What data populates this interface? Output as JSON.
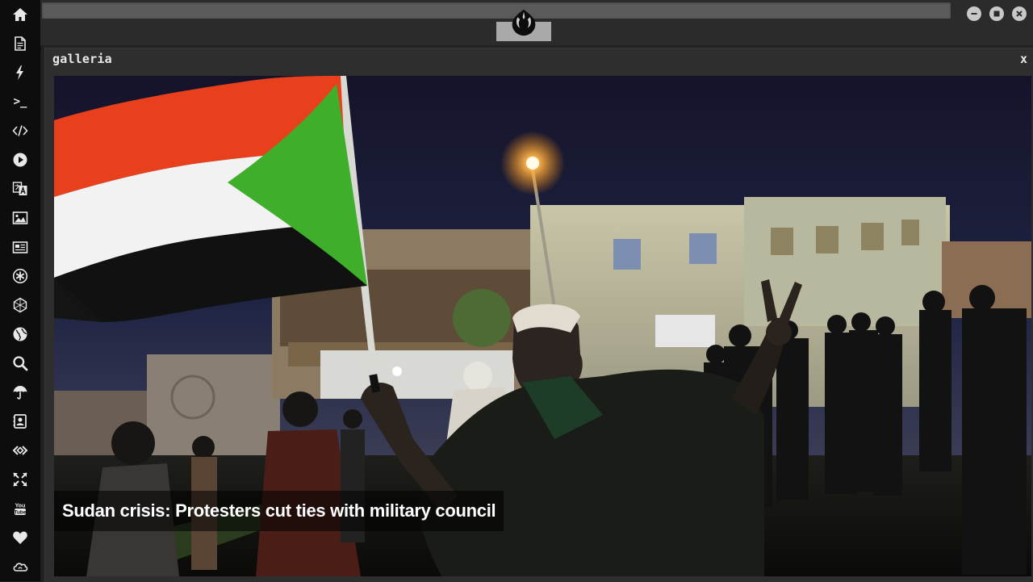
{
  "sidebar": {
    "items": [
      {
        "name": "home-icon"
      },
      {
        "name": "document-icon"
      },
      {
        "name": "lightning-icon"
      },
      {
        "name": "terminal-icon",
        "label": ">_"
      },
      {
        "name": "code-icon",
        "label": "</>"
      },
      {
        "name": "play-icon"
      },
      {
        "name": "translate-icon"
      },
      {
        "name": "image-icon"
      },
      {
        "name": "news-icon"
      },
      {
        "name": "asterisk-icon"
      },
      {
        "name": "hexagon-icon"
      },
      {
        "name": "globe-icon"
      },
      {
        "name": "search-icon"
      },
      {
        "name": "umbrella-icon"
      },
      {
        "name": "contact-card-icon"
      },
      {
        "name": "diamond-code-icon"
      },
      {
        "name": "expand-icon"
      },
      {
        "name": "youtube-icon",
        "label": "You Tube"
      },
      {
        "name": "heart-icon"
      },
      {
        "name": "cloud-icon"
      }
    ]
  },
  "topbar": {
    "logo": "rebel-alliance-logo",
    "window_buttons": [
      "minimize-icon",
      "maximize-icon",
      "close-icon"
    ]
  },
  "gallery": {
    "title": "galleria",
    "close_label": "x",
    "caption": "Sudan crisis: Protesters cut ties with military council"
  },
  "colors": {
    "sidebar_bg": "#0d0d0d",
    "panel_bg": "#2e2e2e",
    "icon": "#e8e8e8",
    "flag_red": "#e8401c",
    "flag_white": "#f2f2f2",
    "flag_black": "#111111",
    "flag_green": "#3fae2a"
  }
}
